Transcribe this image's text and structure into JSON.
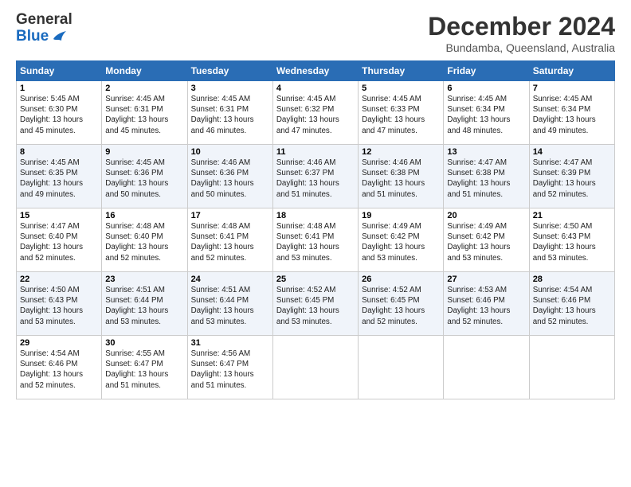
{
  "header": {
    "logo_general": "General",
    "logo_blue": "Blue",
    "month_title": "December 2024",
    "location": "Bundamba, Queensland, Australia"
  },
  "days_of_week": [
    "Sunday",
    "Monday",
    "Tuesday",
    "Wednesday",
    "Thursday",
    "Friday",
    "Saturday"
  ],
  "weeks": [
    [
      {
        "day": "1",
        "sunrise": "5:45 AM",
        "sunset": "6:30 PM",
        "daylight": "13 hours and 45 minutes."
      },
      {
        "day": "2",
        "sunrise": "4:45 AM",
        "sunset": "6:31 PM",
        "daylight": "13 hours and 45 minutes."
      },
      {
        "day": "3",
        "sunrise": "4:45 AM",
        "sunset": "6:31 PM",
        "daylight": "13 hours and 46 minutes."
      },
      {
        "day": "4",
        "sunrise": "4:45 AM",
        "sunset": "6:32 PM",
        "daylight": "13 hours and 47 minutes."
      },
      {
        "day": "5",
        "sunrise": "4:45 AM",
        "sunset": "6:33 PM",
        "daylight": "13 hours and 47 minutes."
      },
      {
        "day": "6",
        "sunrise": "4:45 AM",
        "sunset": "6:34 PM",
        "daylight": "13 hours and 48 minutes."
      },
      {
        "day": "7",
        "sunrise": "4:45 AM",
        "sunset": "6:34 PM",
        "daylight": "13 hours and 49 minutes."
      }
    ],
    [
      {
        "day": "8",
        "sunrise": "4:45 AM",
        "sunset": "6:35 PM",
        "daylight": "13 hours and 49 minutes."
      },
      {
        "day": "9",
        "sunrise": "4:45 AM",
        "sunset": "6:36 PM",
        "daylight": "13 hours and 50 minutes."
      },
      {
        "day": "10",
        "sunrise": "4:46 AM",
        "sunset": "6:36 PM",
        "daylight": "13 hours and 50 minutes."
      },
      {
        "day": "11",
        "sunrise": "4:46 AM",
        "sunset": "6:37 PM",
        "daylight": "13 hours and 51 minutes."
      },
      {
        "day": "12",
        "sunrise": "4:46 AM",
        "sunset": "6:38 PM",
        "daylight": "13 hours and 51 minutes."
      },
      {
        "day": "13",
        "sunrise": "4:47 AM",
        "sunset": "6:38 PM",
        "daylight": "13 hours and 51 minutes."
      },
      {
        "day": "14",
        "sunrise": "4:47 AM",
        "sunset": "6:39 PM",
        "daylight": "13 hours and 52 minutes."
      }
    ],
    [
      {
        "day": "15",
        "sunrise": "4:47 AM",
        "sunset": "6:40 PM",
        "daylight": "13 hours and 52 minutes."
      },
      {
        "day": "16",
        "sunrise": "4:48 AM",
        "sunset": "6:40 PM",
        "daylight": "13 hours and 52 minutes."
      },
      {
        "day": "17",
        "sunrise": "4:48 AM",
        "sunset": "6:41 PM",
        "daylight": "13 hours and 52 minutes."
      },
      {
        "day": "18",
        "sunrise": "4:48 AM",
        "sunset": "6:41 PM",
        "daylight": "13 hours and 53 minutes."
      },
      {
        "day": "19",
        "sunrise": "4:49 AM",
        "sunset": "6:42 PM",
        "daylight": "13 hours and 53 minutes."
      },
      {
        "day": "20",
        "sunrise": "4:49 AM",
        "sunset": "6:42 PM",
        "daylight": "13 hours and 53 minutes."
      },
      {
        "day": "21",
        "sunrise": "4:50 AM",
        "sunset": "6:43 PM",
        "daylight": "13 hours and 53 minutes."
      }
    ],
    [
      {
        "day": "22",
        "sunrise": "4:50 AM",
        "sunset": "6:43 PM",
        "daylight": "13 hours and 53 minutes."
      },
      {
        "day": "23",
        "sunrise": "4:51 AM",
        "sunset": "6:44 PM",
        "daylight": "13 hours and 53 minutes."
      },
      {
        "day": "24",
        "sunrise": "4:51 AM",
        "sunset": "6:44 PM",
        "daylight": "13 hours and 53 minutes."
      },
      {
        "day": "25",
        "sunrise": "4:52 AM",
        "sunset": "6:45 PM",
        "daylight": "13 hours and 53 minutes."
      },
      {
        "day": "26",
        "sunrise": "4:52 AM",
        "sunset": "6:45 PM",
        "daylight": "13 hours and 52 minutes."
      },
      {
        "day": "27",
        "sunrise": "4:53 AM",
        "sunset": "6:46 PM",
        "daylight": "13 hours and 52 minutes."
      },
      {
        "day": "28",
        "sunrise": "4:54 AM",
        "sunset": "6:46 PM",
        "daylight": "13 hours and 52 minutes."
      }
    ],
    [
      {
        "day": "29",
        "sunrise": "4:54 AM",
        "sunset": "6:46 PM",
        "daylight": "13 hours and 52 minutes."
      },
      {
        "day": "30",
        "sunrise": "4:55 AM",
        "sunset": "6:47 PM",
        "daylight": "13 hours and 51 minutes."
      },
      {
        "day": "31",
        "sunrise": "4:56 AM",
        "sunset": "6:47 PM",
        "daylight": "13 hours and 51 minutes."
      },
      null,
      null,
      null,
      null
    ]
  ],
  "labels": {
    "sunrise": "Sunrise:",
    "sunset": "Sunset:",
    "daylight": "Daylight:"
  }
}
